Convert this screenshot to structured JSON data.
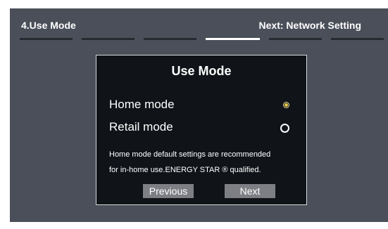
{
  "header": {
    "current_step": "4.Use Mode",
    "next_step": "Next: Network Setting"
  },
  "progress": {
    "total_steps": 6,
    "active_step": 4
  },
  "dialog": {
    "title": "Use Mode",
    "options": [
      {
        "label": "Home mode",
        "selected": true
      },
      {
        "label": "Retail mode",
        "selected": false
      }
    ],
    "description_line1": "Home mode default settings are recommended",
    "description_line2": "for in-home use.ENERGY STAR ® qualified.",
    "previous_label": "Previous",
    "next_label": "Next"
  },
  "colors": {
    "background": "#4a4f59",
    "dialog_background": "#101419",
    "active_step": "#ffffff",
    "inactive_step": "#262a31",
    "button": "#7d7f84",
    "selected_radio": "#e8c94a"
  }
}
